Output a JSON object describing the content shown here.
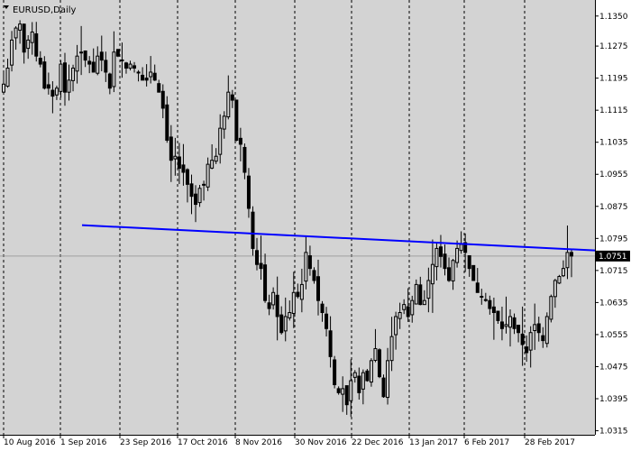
{
  "window": {
    "title": "EURUSD,Daily",
    "menu_icon": "triangle-down-icon"
  },
  "colors": {
    "background": "#d3d3d3",
    "candle": "#000000",
    "trendline": "#0000ff",
    "grid": "#000000",
    "price_line": "#a0a0a0",
    "price_tag": "#000000"
  },
  "chart_data": {
    "type": "candlestick",
    "title": "EURUSD,Daily",
    "symbol": "EURUSD",
    "timeframe": "Daily",
    "y_ticks": [
      1.0315,
      1.0395,
      1.0475,
      1.0555,
      1.0635,
      1.0715,
      1.0795,
      1.0875,
      1.0955,
      1.1035,
      1.1115,
      1.1195,
      1.1275,
      1.135
    ],
    "ylim": [
      1.0305,
      1.139
    ],
    "x_ticks": [
      "10 Aug 2016",
      "1 Sep 2016",
      "23 Sep 2016",
      "17 Oct 2016",
      "8 Nov 2016",
      "30 Nov 2016",
      "22 Dec 2016",
      "13 Jan 2017",
      "6 Feb 2017",
      "28 Feb 2017"
    ],
    "current_price": 1.0751,
    "current_price_label": "1.0751",
    "grid": "vertical dotted lines at x-ticks",
    "trendline": {
      "start": {
        "date": "1 Sep 2016",
        "price": 1.0828
      },
      "end": {
        "date": "last bar",
        "price": 1.0765
      }
    },
    "closes": [
      1.118,
      1.122,
      1.129,
      1.132,
      1.133,
      1.126,
      1.129,
      1.131,
      1.125,
      1.123,
      1.117,
      1.117,
      1.115,
      1.117,
      1.123,
      1.116,
      1.119,
      1.122,
      1.125,
      1.126,
      1.124,
      1.123,
      1.121,
      1.125,
      1.124,
      1.121,
      1.117,
      1.126,
      1.125,
      1.124,
      1.122,
      1.123,
      1.122,
      1.121,
      1.119,
      1.119,
      1.121,
      1.119,
      1.116,
      1.112,
      1.104,
      1.099,
      1.1,
      1.097,
      1.096,
      1.093,
      1.09,
      1.088,
      1.092,
      1.093,
      1.098,
      1.099,
      1.1,
      1.107,
      1.11,
      1.116,
      1.114,
      1.104,
      1.103,
      1.096,
      1.087,
      1.077,
      1.073,
      1.072,
      1.064,
      1.062,
      1.066,
      1.06,
      1.056,
      1.06,
      1.061,
      1.066,
      1.065,
      1.068,
      1.076,
      1.072,
      1.069,
      1.064,
      1.061,
      1.057,
      1.05,
      1.043,
      1.041,
      1.042,
      1.038,
      1.044,
      1.046,
      1.041,
      1.046,
      1.044,
      1.049,
      1.052,
      1.045,
      1.04,
      1.049,
      1.055,
      1.06,
      1.061,
      1.063,
      1.06,
      1.064,
      1.068,
      1.063,
      1.064,
      1.069,
      1.073,
      1.077,
      1.075,
      1.072,
      1.069,
      1.074,
      1.077,
      1.078,
      1.076,
      1.072,
      1.069,
      1.066,
      1.065,
      1.064,
      1.062,
      1.061,
      1.059,
      1.057,
      1.058,
      1.06,
      1.057,
      1.056,
      1.053,
      1.051,
      1.056,
      1.058,
      1.056,
      1.054,
      1.06,
      1.065,
      1.069,
      1.07,
      1.072,
      1.076,
      1.0751
    ]
  }
}
